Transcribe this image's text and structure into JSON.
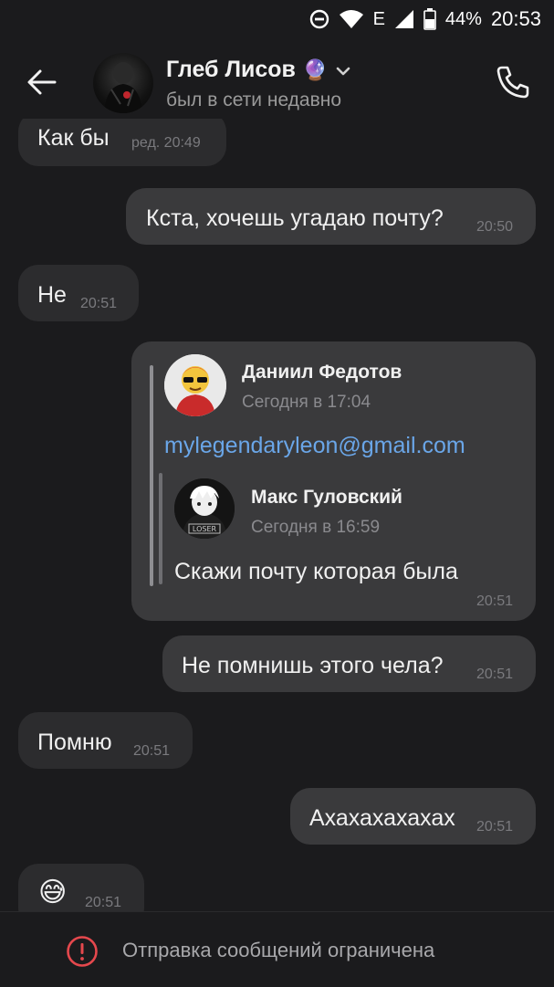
{
  "status_bar": {
    "network": "E",
    "battery": "44%",
    "time": "20:53"
  },
  "header": {
    "back_icon": "arrow-left-icon",
    "name": "Глеб Лисов",
    "name_emoji": "🔮",
    "status": "был в сети недавно",
    "call_icon": "phone-icon"
  },
  "messages": [
    {
      "side": "in",
      "text": "Как бы",
      "time": "ред. 20:49"
    },
    {
      "side": "out",
      "text": "Кста, хочешь угадаю почту?",
      "time": "20:50"
    },
    {
      "side": "in",
      "text": "Не",
      "time": "20:51"
    },
    {
      "side": "out",
      "forwarded": {
        "author": "Даниил Федотов",
        "date": "Сегодня в 17:04",
        "text": "mylegendaryleon@gmail.com",
        "nested": {
          "author": "Макс Гуловский",
          "date": "Сегодня в 16:59",
          "text": "Скажи почту которая была"
        }
      },
      "time": "20:51"
    },
    {
      "side": "out",
      "text": "Не помнишь этого чела?",
      "time": "20:51"
    },
    {
      "side": "in",
      "text": "Помню",
      "time": "20:51"
    },
    {
      "side": "out",
      "text": "Ахахахахахах",
      "time": "20:51"
    },
    {
      "side": "in",
      "text": "😅",
      "time": "20:51"
    }
  ],
  "bottom_bar": {
    "icon": "exclamation-circle-icon",
    "text": "Отправка сообщений ограничена",
    "accent": "#e5484d"
  }
}
